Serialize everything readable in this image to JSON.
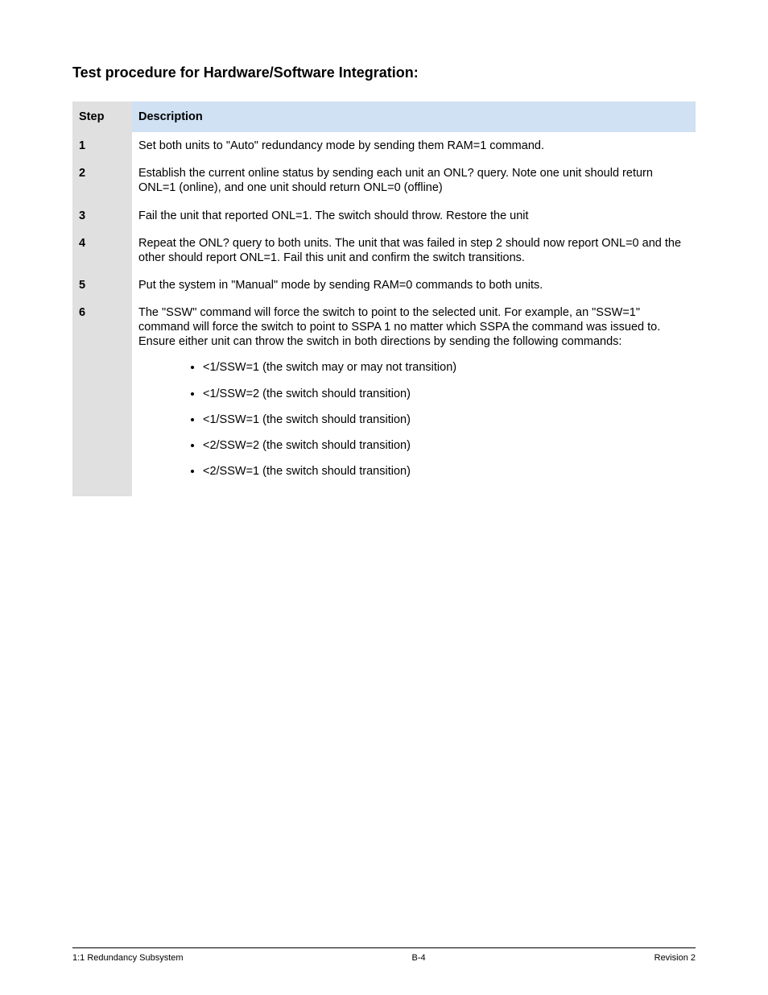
{
  "title": "Test procedure for Hardware/Software Integration:",
  "columns": {
    "step": "Step",
    "desc": "Description"
  },
  "rows": [
    {
      "step": "1",
      "desc": "Set both units to \"Auto\" redundancy mode by sending them RAM=1 command."
    },
    {
      "step": "2",
      "desc": "Establish the current online status by sending each unit an ONL? query. Note one unit should return ONL=1 (online), and one unit should return ONL=0 (offline)"
    },
    {
      "step": "3",
      "desc": "Fail the unit that reported ONL=1. The switch should throw. Restore the unit"
    },
    {
      "step": "4",
      "desc": "Repeat the ONL? query to both units. The unit that was failed in step 2 should now report ONL=0 and the other should report ONL=1. Fail this unit and confirm the switch transitions."
    },
    {
      "step": "5",
      "desc": "Put the system in \"Manual\" mode by sending RAM=0 commands to both units."
    }
  ],
  "row6": {
    "step": "6",
    "intro": "The \"SSW\" command will force the switch to point to the selected unit. For example, an \"SSW=1\" command will force the switch to point to SSPA 1 no matter which SSPA the command was issued to. Ensure either unit can throw the switch in both directions by sending the following commands:",
    "bullets": [
      "<1/SSW=1  (the switch may or may not transition)",
      "<1/SSW=2   (the switch should transition)",
      "<1/SSW=1   (the switch should transition)",
      "<2/SSW=2   (the switch should transition)",
      "<2/SSW=1   (the switch should transition)"
    ]
  },
  "footer": {
    "left": "1:1 Redundancy Subsystem",
    "center": "B-4",
    "right": "Revision 2"
  }
}
